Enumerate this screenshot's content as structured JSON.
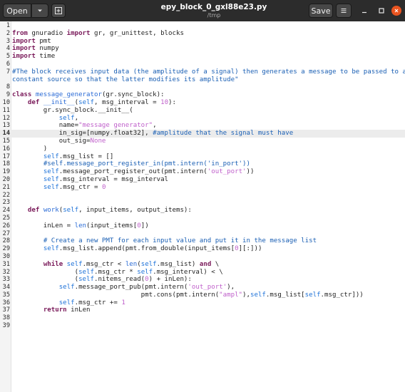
{
  "header": {
    "open_label": "Open",
    "title": "epy_block_0_gxl88e23.py",
    "subtitle": "/tmp",
    "save_label": "Save"
  },
  "icons": {
    "open_menu": "chevron-down-icon",
    "new_tab": "new-tab-icon",
    "menu": "hamburger-menu-icon",
    "minimize": "minimize-icon",
    "maximize": "maximize-icon",
    "close": "close-icon"
  },
  "colors": {
    "titlebar": "#2c2c2c",
    "close": "#e95420",
    "keyword": "#7a1a5a",
    "comment": "#1a5fb4",
    "string": "#c061cb",
    "self": "#1c71d8"
  },
  "editor": {
    "current_line": 14,
    "lines": [
      [
        {
          "t": ""
        }
      ],
      [
        {
          "t": "from",
          "c": "kw"
        },
        {
          "t": " gnuradio "
        },
        {
          "t": "import",
          "c": "kw"
        },
        {
          "t": " gr, gr_unittest, blocks"
        }
      ],
      [
        {
          "t": "import",
          "c": "kw"
        },
        {
          "t": " pmt"
        }
      ],
      [
        {
          "t": "import",
          "c": "kw"
        },
        {
          "t": " numpy"
        }
      ],
      [
        {
          "t": "import",
          "c": "kw"
        },
        {
          "t": " time"
        }
      ],
      [
        {
          "t": ""
        }
      ],
      [
        {
          "t": "#The block receives input data (the amplitude of a signal) then generates a message to be passed to a",
          "c": "tok-comment"
        }
      ],
      [
        {
          "t": ""
        }
      ],
      [
        {
          "t": "class",
          "c": "kw"
        },
        {
          "t": " message_generator",
          "c": "tok-special"
        },
        {
          "t": "(gr.sync_block):"
        }
      ],
      [
        {
          "t": "    "
        },
        {
          "t": "def",
          "c": "kw"
        },
        {
          "t": " __init__",
          "c": "tok-special"
        },
        {
          "t": "("
        },
        {
          "t": "self",
          "c": "tok-self"
        },
        {
          "t": ", msg_interval = "
        },
        {
          "t": "10",
          "c": "tok-num"
        },
        {
          "t": "):"
        }
      ],
      [
        {
          "t": "        gr.sync_block.__init__("
        }
      ],
      [
        {
          "t": "            "
        },
        {
          "t": "self",
          "c": "tok-self"
        },
        {
          "t": ","
        }
      ],
      [
        {
          "t": "            name="
        },
        {
          "t": "\"message generator\"",
          "c": "tok-string"
        },
        {
          "t": ","
        }
      ],
      [
        {
          "t": "            in_sig=[numpy.float32], "
        },
        {
          "t": "#amplitude that the signal must have",
          "c": "tok-comment"
        }
      ],
      [
        {
          "t": "            out_sig="
        },
        {
          "t": "None",
          "c": "tok-string"
        }
      ],
      [
        {
          "t": "        )"
        }
      ],
      [
        {
          "t": "        "
        },
        {
          "t": "self",
          "c": "tok-self"
        },
        {
          "t": ".msg_list = []"
        }
      ],
      [
        {
          "t": "        "
        },
        {
          "t": "#self.message_port_register_in(pmt.intern('in_port'))",
          "c": "tok-comment"
        }
      ],
      [
        {
          "t": "        "
        },
        {
          "t": "self",
          "c": "tok-self"
        },
        {
          "t": ".message_port_register_out(pmt.intern("
        },
        {
          "t": "'out_port'",
          "c": "tok-string"
        },
        {
          "t": "))"
        }
      ],
      [
        {
          "t": "        "
        },
        {
          "t": "self",
          "c": "tok-self"
        },
        {
          "t": ".msg_interval = msg_interval"
        }
      ],
      [
        {
          "t": "        "
        },
        {
          "t": "self",
          "c": "tok-self"
        },
        {
          "t": ".msg_ctr = "
        },
        {
          "t": "0",
          "c": "tok-num"
        }
      ],
      [
        {
          "t": ""
        }
      ],
      [
        {
          "t": ""
        }
      ],
      [
        {
          "t": "    "
        },
        {
          "t": "def",
          "c": "kw"
        },
        {
          "t": " work",
          "c": "tok-special"
        },
        {
          "t": "("
        },
        {
          "t": "self",
          "c": "tok-self"
        },
        {
          "t": ", input_items, output_items):"
        }
      ],
      [
        {
          "t": ""
        }
      ],
      [
        {
          "t": "        inLen = "
        },
        {
          "t": "len",
          "c": "tok-special"
        },
        {
          "t": "(input_items["
        },
        {
          "t": "0",
          "c": "tok-num"
        },
        {
          "t": "])"
        }
      ],
      [
        {
          "t": ""
        }
      ],
      [
        {
          "t": "        "
        },
        {
          "t": "# Create a new PMT for each input value and put it in the message list",
          "c": "tok-comment"
        }
      ],
      [
        {
          "t": "        "
        },
        {
          "t": "self",
          "c": "tok-self"
        },
        {
          "t": ".msg_list.append(pmt.from_double(input_items["
        },
        {
          "t": "0",
          "c": "tok-num"
        },
        {
          "t": "][:]))"
        }
      ],
      [
        {
          "t": ""
        }
      ],
      [
        {
          "t": "        "
        },
        {
          "t": "while",
          "c": "kw"
        },
        {
          "t": " "
        },
        {
          "t": "self",
          "c": "tok-self"
        },
        {
          "t": ".msg_ctr < "
        },
        {
          "t": "len",
          "c": "tok-special"
        },
        {
          "t": "("
        },
        {
          "t": "self",
          "c": "tok-self"
        },
        {
          "t": ".msg_list) "
        },
        {
          "t": "and",
          "c": "kw"
        },
        {
          "t": " \\"
        }
      ],
      [
        {
          "t": "                ("
        },
        {
          "t": "self",
          "c": "tok-self"
        },
        {
          "t": ".msg_ctr * "
        },
        {
          "t": "self",
          "c": "tok-self"
        },
        {
          "t": ".msg_interval) < \\"
        }
      ],
      [
        {
          "t": "                ("
        },
        {
          "t": "self",
          "c": "tok-self"
        },
        {
          "t": ".nitems_read("
        },
        {
          "t": "0",
          "c": "tok-num"
        },
        {
          "t": ") + inLen):"
        }
      ],
      [
        {
          "t": "            "
        },
        {
          "t": "self",
          "c": "tok-self"
        },
        {
          "t": ".message_port_pub(pmt.intern("
        },
        {
          "t": "'out_port'",
          "c": "tok-string"
        },
        {
          "t": "),"
        }
      ],
      [
        {
          "t": "                                 pmt.cons(pmt.intern("
        },
        {
          "t": "\"ampl\"",
          "c": "tok-string"
        },
        {
          "t": "),"
        },
        {
          "t": "self",
          "c": "tok-self"
        },
        {
          "t": ".msg_list["
        },
        {
          "t": "self",
          "c": "tok-self"
        },
        {
          "t": ".msg_ctr]))"
        }
      ],
      [
        {
          "t": "            "
        },
        {
          "t": "self",
          "c": "tok-self"
        },
        {
          "t": ".msg_ctr += "
        },
        {
          "t": "1",
          "c": "tok-num"
        }
      ],
      [
        {
          "t": "        "
        },
        {
          "t": "return",
          "c": "kw"
        },
        {
          "t": " inLen"
        }
      ],
      [
        {
          "t": ""
        }
      ],
      [
        {
          "t": ""
        }
      ]
    ],
    "continuations": {
      "7": [
        {
          "t": "constant source so that the latter modifies its amplitude\"",
          "c": "tok-comment"
        }
      ]
    }
  }
}
